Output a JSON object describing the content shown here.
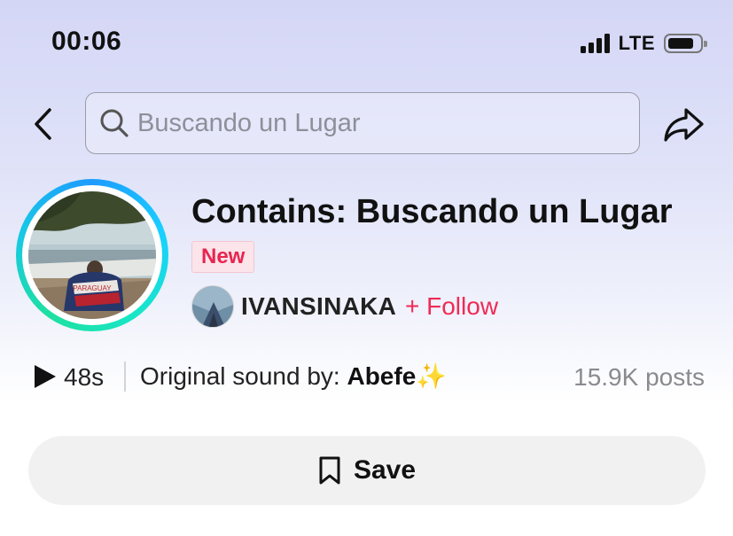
{
  "status_bar": {
    "time": "00:06",
    "network": "LTE"
  },
  "search": {
    "placeholder": "Buscando un Lugar",
    "value": ""
  },
  "header": {
    "title": "Contains: Buscando un Lugar",
    "badge": "New",
    "creator_name": "IVANSINAKA",
    "follow_label": "+ Follow"
  },
  "sound": {
    "duration": "48s",
    "prefix": "Original sound by: ",
    "author": "Abefe✨",
    "posts": "15.9K posts"
  },
  "save": {
    "label": "Save"
  },
  "colors": {
    "accent": "#ef2b55",
    "badge_bg": "#fbe4ea",
    "ring_start": "#1e9bff",
    "ring_end": "#1ee0a0"
  },
  "icons": [
    "back-icon",
    "search-icon",
    "share-icon",
    "play-icon",
    "bookmark-icon"
  ]
}
